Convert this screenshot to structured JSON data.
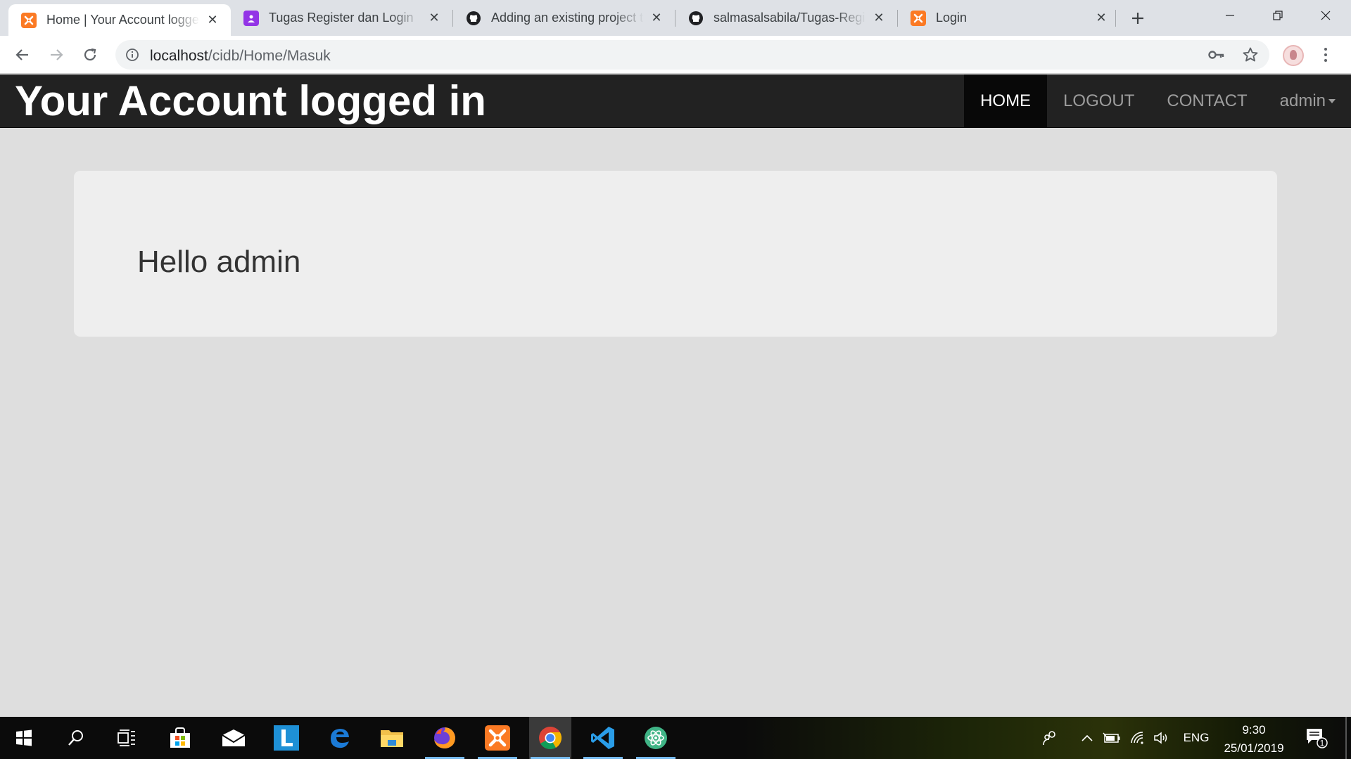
{
  "browser": {
    "tabs": [
      {
        "title": "Home | Your Account logged in",
        "favicon": "xampp-icon",
        "active": true
      },
      {
        "title": "Tugas Register dan Login",
        "favicon": "google-classroom-icon",
        "active": false
      },
      {
        "title": "Adding an existing project to GitHub",
        "favicon": "github-icon",
        "active": false
      },
      {
        "title": "salmasalsabila/Tugas-Register",
        "favicon": "github-icon",
        "active": false
      },
      {
        "title": "Login",
        "favicon": "xampp-icon",
        "active": false
      }
    ],
    "address": {
      "host": "localhost",
      "path": "/cidb/Home/Masuk"
    }
  },
  "page": {
    "brand": "Your Account logged in",
    "nav": {
      "home": "HOME",
      "logout": "LOGOUT",
      "contact": "CONTACT",
      "user": "admin"
    },
    "greeting": "Hello admin"
  },
  "taskbar": {
    "apps": [
      "windows-start-icon",
      "search-icon",
      "task-view-icon",
      "microsoft-store-icon",
      "mail-icon",
      "l-app-icon",
      "edge-icon",
      "file-explorer-icon",
      "firefox-icon",
      "xampp-icon",
      "chrome-icon",
      "vscode-icon",
      "atom-icon"
    ],
    "language": "ENG",
    "time": "9:30",
    "date": "25/01/2019",
    "notification_count": "1"
  },
  "colors": {
    "navbar": "#222222",
    "page_background": "#dedede",
    "jumbotron": "#eeeeee",
    "xampp": "#fb7a24"
  }
}
